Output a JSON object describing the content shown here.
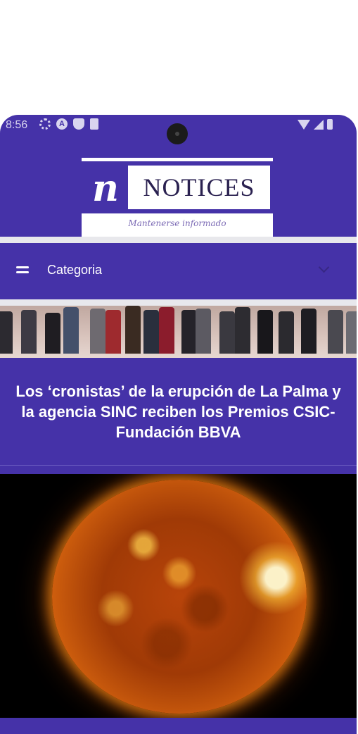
{
  "status_bar": {
    "time": "8:56",
    "left_icons": [
      "gear-icon",
      "a-icon",
      "shield-icon",
      "sd-card-icon"
    ],
    "right_icons": [
      "wifi-icon",
      "signal-icon",
      "battery-icon"
    ]
  },
  "logo": {
    "mark": "n",
    "title": "NOTICES",
    "subtitle": "Mantenerse informado"
  },
  "navbar": {
    "menu_icon": "menu-icon",
    "category_label": "Categoria",
    "dropdown_icon": "chevron-down-icon"
  },
  "articles": [
    {
      "headline": "Los ‘cronistas’ de la erupción de La Palma y la agencia SINC reciben los Premios CSIC-Fundación BBVA"
    }
  ],
  "colors": {
    "primary": "#4532a8",
    "strip": "#e8e8ec",
    "text_on_primary": "#ffffff"
  }
}
